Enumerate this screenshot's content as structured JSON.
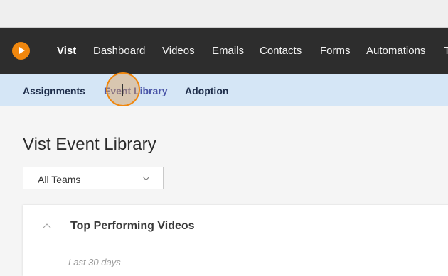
{
  "nav": {
    "brand": "Vist",
    "items": [
      "Dashboard",
      "Videos",
      "Emails",
      "Contacts",
      "Forms",
      "Automations",
      "T"
    ]
  },
  "subnav": {
    "items": [
      "Assignments",
      "Event Library",
      "Adoption"
    ],
    "active": "Event Library"
  },
  "page": {
    "title": "Vist Event Library"
  },
  "filter": {
    "selected": "All Teams"
  },
  "card": {
    "title": "Top Performing Videos",
    "subtitle": "Last 30 days"
  },
  "colors": {
    "nav_bg": "#2d2d2d",
    "subnav_bg": "#d5e6f6",
    "accent": "#f0870e",
    "active_link": "#4b56a8"
  },
  "icons": [
    "vist-logo-icon",
    "chevron-down-icon",
    "chevron-up-icon"
  ]
}
